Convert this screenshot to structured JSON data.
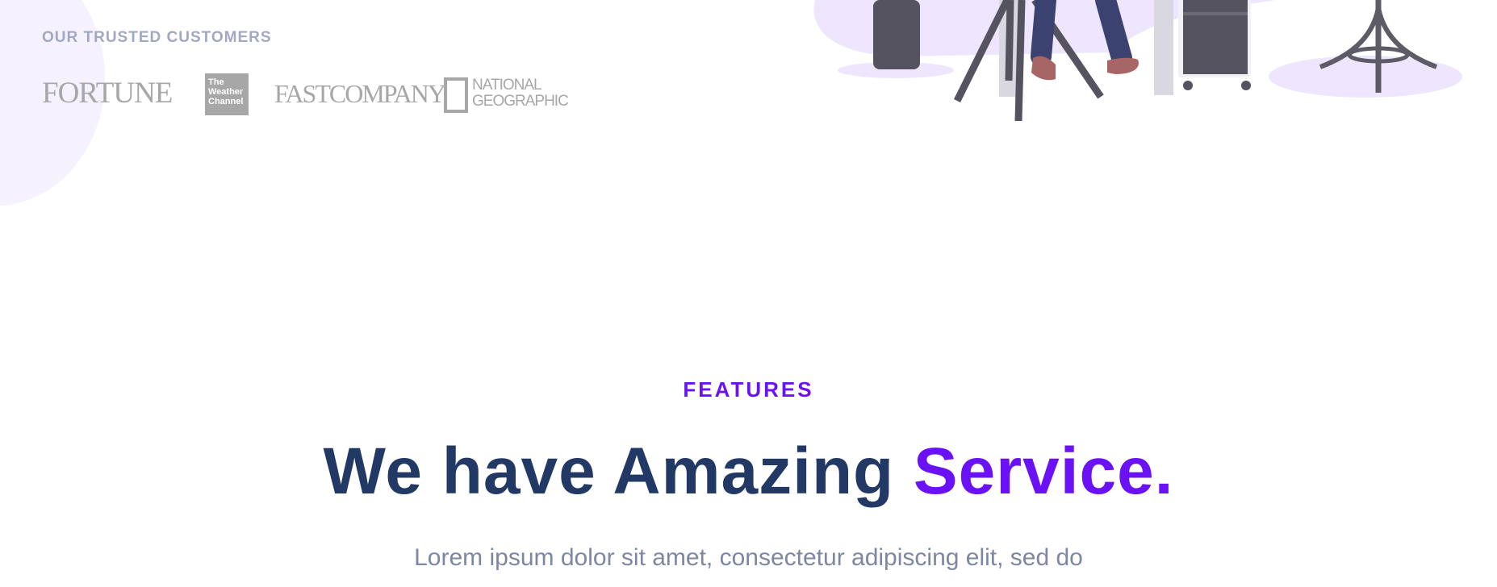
{
  "trusted": {
    "label": "OUR TRUSTED CUSTOMERS",
    "logos": [
      {
        "name": "fortune",
        "text": "FORTUNE"
      },
      {
        "name": "weather-channel",
        "lines": [
          "The",
          "Weather",
          "Channel"
        ]
      },
      {
        "name": "fast-company",
        "text": "FASTCOMPANY"
      },
      {
        "name": "national-geographic",
        "lines": [
          "NATIONAL",
          "GEOGRAPHIC"
        ]
      }
    ]
  },
  "features": {
    "tag": "FEATURES",
    "headline_main": "We have Amazing ",
    "headline_accent": "Service.",
    "intro": "Lorem ipsum dolor sit amet, consectetur adipiscing elit, sed do"
  },
  "colors": {
    "accent": "#6a11f5",
    "heading": "#223965",
    "muted": "#7d87a3",
    "logo_gray": "#a7a7a7",
    "blob": "#f5f1fe"
  }
}
